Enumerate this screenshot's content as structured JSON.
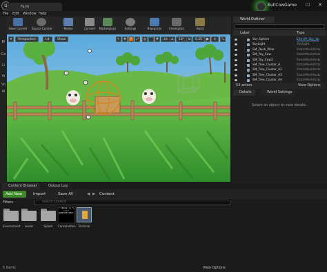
{
  "window": {
    "tab_title": "Farm",
    "project_name": "BullCowGame",
    "controls": {
      "minimize": "–",
      "maximize": "☐",
      "close": "✕"
    }
  },
  "menu": {
    "items": [
      "File",
      "Edit",
      "Window",
      "Help"
    ]
  },
  "toolbar": {
    "buttons": [
      {
        "label": "Save Current",
        "icon": "save-icon",
        "color": "#4a6fa5"
      },
      {
        "label": "Source Control",
        "icon": "source-control-icon",
        "color": "#6a6a6a"
      },
      {
        "label": "Modes",
        "icon": "modes-icon",
        "color": "#5b7fae"
      },
      {
        "label": "Content",
        "icon": "content-icon",
        "color": "#8a8a8a"
      },
      {
        "label": "Marketplace",
        "icon": "marketplace-icon",
        "color": "#5a8a5a"
      },
      {
        "label": "Settings",
        "icon": "settings-icon",
        "color": "#7a7a7a"
      },
      {
        "label": "Blueprints",
        "icon": "blueprints-icon",
        "color": "#4a7ab0"
      },
      {
        "label": "Cinematics",
        "icon": "cinematics-icon",
        "color": "#6a6a6a"
      },
      {
        "label": "Build",
        "icon": "build-icon",
        "color": "#8a7a4a"
      }
    ]
  },
  "modes_strip": {
    "labels": [
      "Bl",
      "Ge",
      "Li",
      "Vi",
      "Vo",
      "Al"
    ]
  },
  "viewport": {
    "perspective_label": "Perspective",
    "lit_label": "Lit",
    "show_label": "Show",
    "snap_value": "10",
    "rotation_snap": "10°",
    "scale_snap": "0.25",
    "camera_speed": "4"
  },
  "outliner": {
    "tab_title": "World Outliner",
    "col_label": "Label",
    "col_type": "Type",
    "rows": [
      {
        "name": "Sky Sphere",
        "type": "Edit BP_Sky_Sp",
        "type_is_link": true
      },
      {
        "name": "SkyLight",
        "type": "SkyLight"
      },
      {
        "name": "SM_Dock_Pillar",
        "type": "StaticMeshActor"
      },
      {
        "name": "SM_Toy_Cow",
        "type": "StaticMeshActor"
      },
      {
        "name": "SM_Toy_Cow2",
        "type": "StaticMeshActor"
      },
      {
        "name": "SM_Tree_Cluster_A",
        "type": "StaticMeshActor"
      },
      {
        "name": "SM_Tree_Cluster_A2",
        "type": "StaticMeshActor"
      },
      {
        "name": "SM_Tree_Cluster_A3",
        "type": "StaticMeshActor"
      },
      {
        "name": "SM_Tree_Cluster_A4",
        "type": "StaticMeshActor"
      }
    ],
    "actor_count": "53 actors",
    "view_options": "View Options"
  },
  "details": {
    "tabs": [
      "Details",
      "World Settings"
    ],
    "message": "Select an object to view details."
  },
  "content_browser": {
    "tabs": [
      "Content Browser",
      "Output Log"
    ],
    "add_new": "Add New",
    "import": "Import",
    "save_all": "Save All",
    "path_root": "Content",
    "filters": "Filters",
    "search_placeholder": "Search Content",
    "assets": [
      {
        "label": "Environment",
        "kind": "folder"
      },
      {
        "label": "Levels",
        "kind": "folder"
      },
      {
        "label": "Splash",
        "kind": "folder"
      },
      {
        "label": "Consolastion",
        "kind": "font"
      },
      {
        "label": "Terminal",
        "kind": "blueprint"
      }
    ],
    "item_count": "5 items",
    "view_options": "View Options"
  },
  "colors": {
    "accent_green": "#3e8a2a",
    "link_blue": "#6fa8ff",
    "sky": "#7cc2e8",
    "grass": "#3da33a"
  }
}
